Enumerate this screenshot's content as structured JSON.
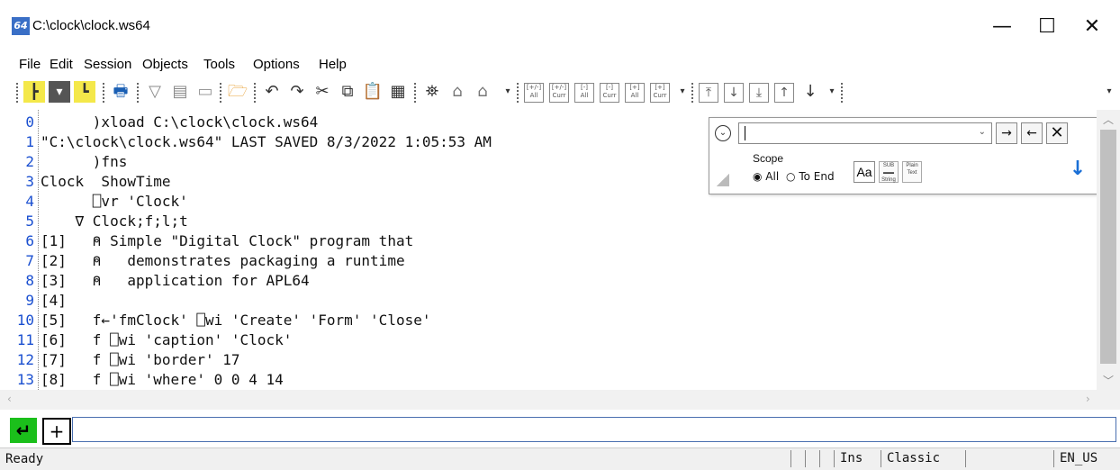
{
  "window": {
    "title": "C:\\clock\\clock.ws64",
    "app_icon_label": "64",
    "minimize": "—",
    "maximize": "☐",
    "close": "✕"
  },
  "menu": [
    "File",
    "Edit",
    "Session",
    "Objects",
    "Tools",
    "Options",
    "Help"
  ],
  "toolbar": {
    "find_all_lbl": "All",
    "find_curr_lbl": "Curr"
  },
  "editor": {
    "lines": [
      {
        "num": "0",
        "text": "      )xload C:\\clock\\clock.ws64"
      },
      {
        "num": "1",
        "text": "\"C:\\clock\\clock.ws64\" LAST SAVED 8/3/2022 1:05:53 AM"
      },
      {
        "num": "2",
        "text": "      )fns"
      },
      {
        "num": "3",
        "text": "Clock  ShowTime"
      },
      {
        "num": "4",
        "text": "      ⎕vr 'Clock'"
      },
      {
        "num": "5",
        "text": "    ∇ Clock;f;l;t"
      },
      {
        "num": "6",
        "text": "[1]   ⍝ Simple \"Digital Clock\" program that"
      },
      {
        "num": "7",
        "text": "[2]   ⍝   demonstrates packaging a runtime"
      },
      {
        "num": "8",
        "text": "[3]   ⍝   application for APL64"
      },
      {
        "num": "9",
        "text": "[4]"
      },
      {
        "num": "10",
        "text": "[5]   f←'fmClock' ⎕wi 'Create' 'Form' 'Close'"
      },
      {
        "num": "11",
        "text": "[6]   f ⎕wi 'caption' 'Clock'"
      },
      {
        "num": "12",
        "text": "[7]   f ⎕wi 'border' 17"
      },
      {
        "num": "13",
        "text": "[8]   f ⎕wi 'where' 0 0 4 14"
      }
    ]
  },
  "find_panel": {
    "search_value": "",
    "next_arrow": "→",
    "prev_arrow": "←",
    "close": "✕",
    "scope_label": "Scope",
    "scope_all": "All",
    "scope_to_end": "To End",
    "match_case": "Aa",
    "sub_string_top": "SUB",
    "sub_string_bottom": "String",
    "plain_text_top": "Plain",
    "plain_text_bottom": "Text",
    "down_arrow": "↓"
  },
  "command": {
    "exec_icon": "↵",
    "plus_icon": "+",
    "value": ""
  },
  "status": {
    "text": "Ready",
    "ins": "Ins",
    "mode": "Classic",
    "locale": "EN_US"
  }
}
